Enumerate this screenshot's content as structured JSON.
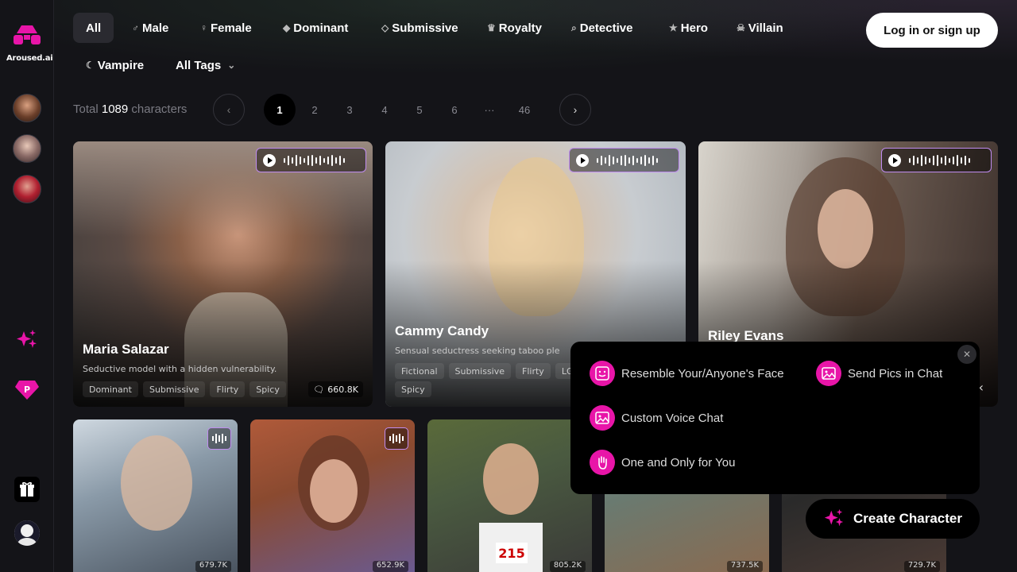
{
  "brand": {
    "name": "Aroused.ai",
    "accent": "#e815a8"
  },
  "tags": [
    {
      "label": "All",
      "icon": ""
    },
    {
      "label": "Male",
      "icon": "male-icon"
    },
    {
      "label": "Female",
      "icon": "female-icon"
    },
    {
      "label": "Dominant",
      "icon": "dominant-icon"
    },
    {
      "label": "Submissive",
      "icon": "submissive-icon"
    },
    {
      "label": "Royalty",
      "icon": "crown-icon"
    },
    {
      "label": "Detective",
      "icon": "magnifier-icon"
    },
    {
      "label": "Hero",
      "icon": "hero-icon"
    },
    {
      "label": "Villain",
      "icon": "villain-icon"
    },
    {
      "label": "Vampire",
      "icon": "vampire-icon"
    },
    {
      "label": "All Tags",
      "icon": "chevron-down-icon"
    }
  ],
  "header": {
    "login_label": "Log in or sign up"
  },
  "pagination": {
    "total_prefix": "Total",
    "total_count": "1089",
    "total_suffix": "characters",
    "pages": [
      "1",
      "2",
      "3",
      "4",
      "5",
      "6",
      "···",
      "46"
    ],
    "current": "1"
  },
  "cards": [
    {
      "name": "Maria Salazar",
      "description": "Seductive model with a hidden vulnerability.",
      "chips": [
        "Dominant",
        "Submissive",
        "Flirty",
        "Spicy"
      ],
      "count": "660.8K"
    },
    {
      "name": "Cammy Candy",
      "description": "Sensual seductress seeking taboo ple",
      "chips": [
        "Fictional",
        "Submissive",
        "Flirty",
        "LGB",
        "Spicy"
      ],
      "count": ""
    },
    {
      "name": "Riley Evans",
      "description": "",
      "chips": [],
      "count": ""
    }
  ],
  "small_cards": [
    {
      "count": "679.7K"
    },
    {
      "count": "652.9K"
    },
    {
      "count": "805.2K"
    },
    {
      "count": "737.5K"
    },
    {
      "count": "729.7K"
    }
  ],
  "popup": {
    "features": [
      {
        "label": "Resemble Your/Anyone's Face",
        "icon": "face-icon"
      },
      {
        "label": "Send Pics in Chat",
        "icon": "picture-icon"
      },
      {
        "label": "Custom Voice Chat",
        "icon": "picture-icon"
      },
      {
        "label": "One and Only for You",
        "icon": "hand-icon"
      }
    ]
  },
  "create_label": "Create Character"
}
